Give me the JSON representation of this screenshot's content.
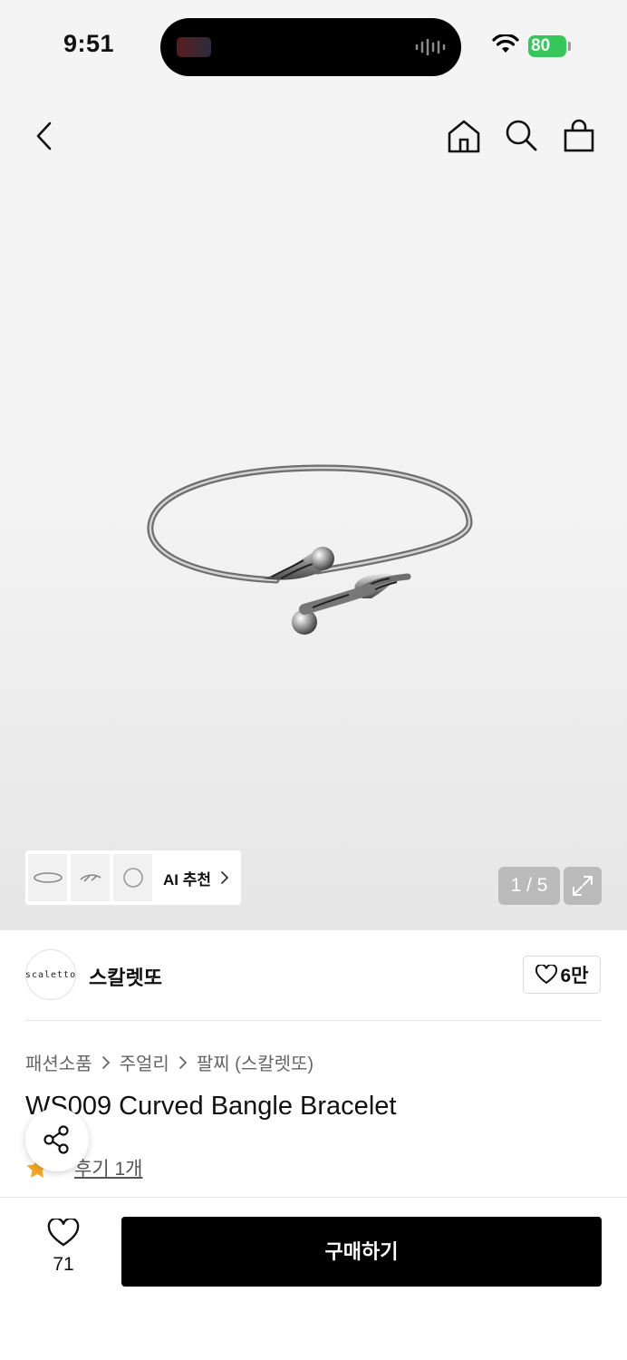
{
  "status_bar": {
    "time": "9:51",
    "battery": "80"
  },
  "gallery": {
    "page_indicator": "1 / 5",
    "ai_recommend_label": "AI 추천"
  },
  "brand": {
    "logo_text": "scaletto",
    "name": "스칼렛또",
    "likes": "6만"
  },
  "breadcrumb": [
    "패션소품",
    "주얼리",
    "팔찌 (스칼렛또)"
  ],
  "product": {
    "title": "WS009 Curved Bangle Bracelet",
    "review_link": "후기 1개"
  },
  "bottom_bar": {
    "wish_count": "71",
    "buy_label": "구매하기"
  },
  "colors": {
    "star": "#f5a623",
    "buy_button": "#000000",
    "battery": "#34c759"
  }
}
